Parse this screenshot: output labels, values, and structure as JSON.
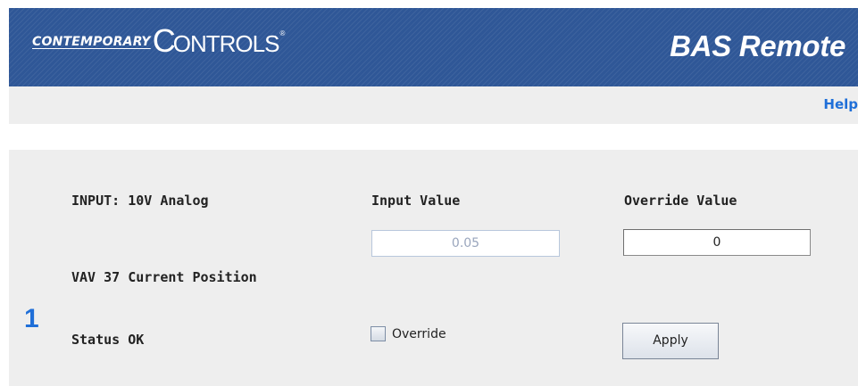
{
  "header": {
    "logo_word1": "CONTEMPORARY",
    "logo_c": "C",
    "logo_word2": "ONTROLS",
    "logo_reg": "®",
    "product_title": "BAS Remote"
  },
  "helpbar": {
    "help_label": "Help"
  },
  "point": {
    "channel_number": "1",
    "input_type_label": "INPUT: 10V Analog",
    "input_value_header": "Input Value",
    "override_value_header": "Override Value",
    "input_value": "0.05",
    "override_value": "0",
    "point_name": "VAV 37 Current Position",
    "status_text": "Status OK",
    "override_checkbox_label": "Override",
    "override_checked": false,
    "apply_label": "Apply"
  },
  "colors": {
    "banner": "#2f5797",
    "panel": "#eeeeee",
    "accent_link": "#1f6fd8"
  }
}
